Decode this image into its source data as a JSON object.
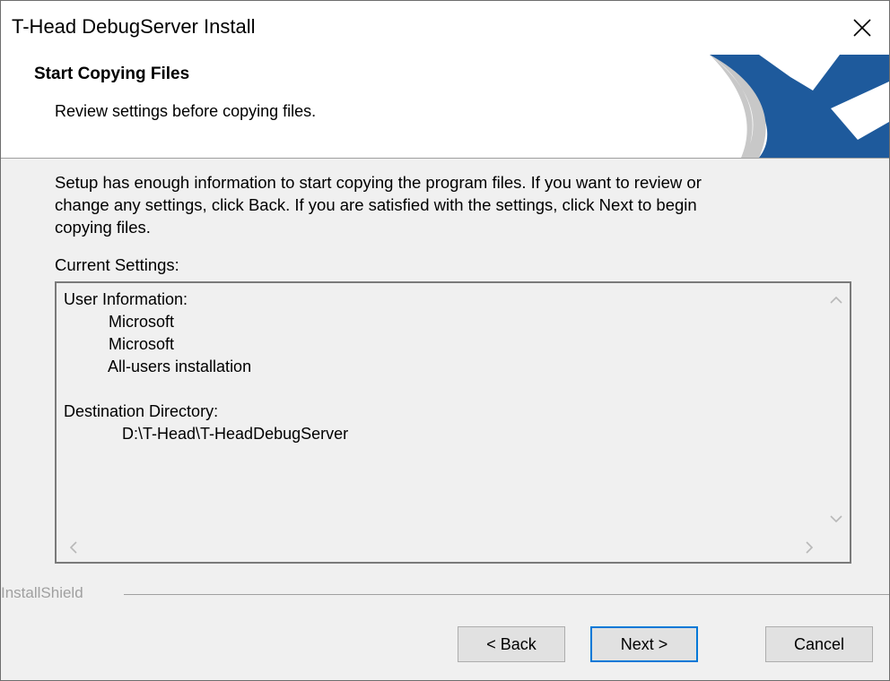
{
  "window": {
    "title": "T-Head DebugServer Install"
  },
  "header": {
    "title": "Start Copying Files",
    "subtitle": "Review settings before copying files."
  },
  "body": {
    "intro_lines": [
      "Setup has enough information to start copying the program files.  If you want to review or",
      "change any settings, click Back.  If you are satisfied with the settings, click Next to begin",
      "copying files."
    ],
    "settings_label": "Current Settings:",
    "settings_lines": [
      "User Information:",
      "          Microsoft",
      "          Microsoft",
      "          All-users installation",
      "",
      "Destination Directory:",
      "             D:\\T-Head\\T-HeadDebugServer"
    ]
  },
  "footer": {
    "brand": "InstallShield",
    "back_label": "< Back",
    "next_label": "Next >",
    "cancel_label": "Cancel"
  },
  "icons": {
    "close": "close-icon",
    "scroll_up": "chevron-up-icon",
    "scroll_down": "chevron-down-icon",
    "scroll_left": "chevron-left-icon",
    "scroll_right": "chevron-right-icon"
  },
  "colors": {
    "logo_blue": "#1e5a9c",
    "default_button_border": "#0078d7"
  }
}
